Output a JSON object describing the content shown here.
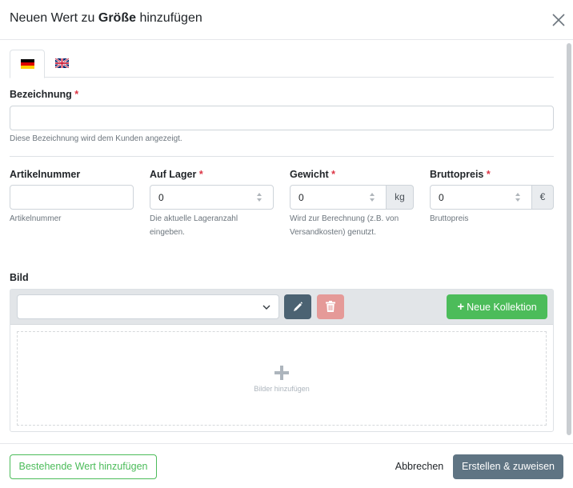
{
  "modal": {
    "title_prefix": "Neuen Wert zu ",
    "title_bold": "Größe",
    "title_suffix": " hinzufügen"
  },
  "language_tabs": [
    {
      "code": "de",
      "flag": "germany-flag-icon",
      "active": true
    },
    {
      "code": "en",
      "flag": "uk-flag-icon",
      "active": false
    }
  ],
  "fields": {
    "bezeichnung": {
      "label": "Bezeichnung",
      "required_mark": "*",
      "value": "",
      "help": "Diese Bezeichnung wird dem Kunden angezeigt."
    },
    "artikelnummer": {
      "label": "Artikelnummer",
      "value": "",
      "help": "Artikelnummer"
    },
    "auf_lager": {
      "label": "Auf Lager",
      "required_mark": "*",
      "value": "0",
      "help": "Die aktuelle Lageranzahl eingeben."
    },
    "gewicht": {
      "label": "Gewicht",
      "required_mark": "*",
      "value": "0",
      "unit": "kg",
      "help": "Wird zur Berechnung (z.B. von Versandkosten) genutzt."
    },
    "bruttopreis": {
      "label": "Bruttopreis",
      "required_mark": "*",
      "value": "0",
      "unit": "€",
      "help": "Bruttopreis"
    }
  },
  "image": {
    "label": "Bild",
    "collection_select_value": "",
    "new_collection_button": "Neue Kollektion",
    "dropzone_text": "Bilder hinzufügen"
  },
  "footer": {
    "existing_button": "Bestehende Wert hinzufügen",
    "cancel_button": "Abbrechen",
    "submit_button": "Erstellen & zuweisen"
  },
  "colors": {
    "green": "#4cbc5a",
    "required": "#dc3545",
    "primary": "#5f7483",
    "edit": "#4b6272",
    "delete": "#e59a98"
  }
}
